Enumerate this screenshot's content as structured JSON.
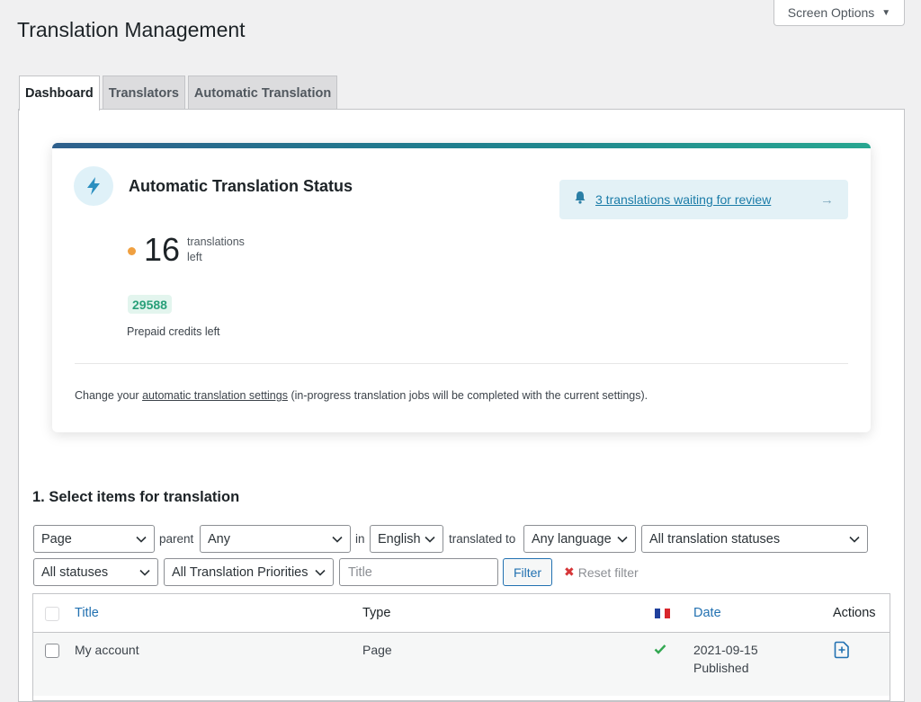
{
  "header": {
    "title": "Translation Management",
    "screen_options": "Screen Options"
  },
  "tabs": [
    {
      "label": "Dashboard",
      "active": true
    },
    {
      "label": "Translators",
      "active": false
    },
    {
      "label": "Automatic Translation",
      "active": false
    }
  ],
  "status_card": {
    "title": "Automatic Translation Status",
    "review_link": "3 translations waiting for review",
    "translations_left": "16",
    "translations_left_label_1": "translations",
    "translations_left_label_2": "left",
    "credits": "29588",
    "credits_label": "Prepaid credits left",
    "settings_prefix": "Change your",
    "settings_link": "automatic translation settings",
    "settings_suffix": "(in-progress translation jobs will be completed with the current settings).",
    "colors": {
      "accent_start": "#2e5f8c",
      "accent_end": "#27a690",
      "dot": "#f0a040",
      "credits": "#2aa07a"
    }
  },
  "section": {
    "title": "1. Select items for translation"
  },
  "filters": {
    "type": "Page",
    "parent_label": "parent",
    "parent": "Any",
    "in_label": "in",
    "language": "English",
    "translated_to_label": "translated to",
    "target_language": "Any language",
    "translation_status": "All translation statuses",
    "status": "All statuses",
    "priority": "All Translation Priorities",
    "title_placeholder": "Title",
    "filter_button": "Filter",
    "reset_label": "Reset filter"
  },
  "table": {
    "columns": {
      "title": "Title",
      "type": "Type",
      "language_flag": "french-flag-icon",
      "date": "Date",
      "actions": "Actions"
    },
    "rows": [
      {
        "title": "My account",
        "type": "Page",
        "status_icon": "check-icon",
        "date": "2021-09-15",
        "state": "Published",
        "action_icon": "add-translation-icon"
      }
    ]
  }
}
